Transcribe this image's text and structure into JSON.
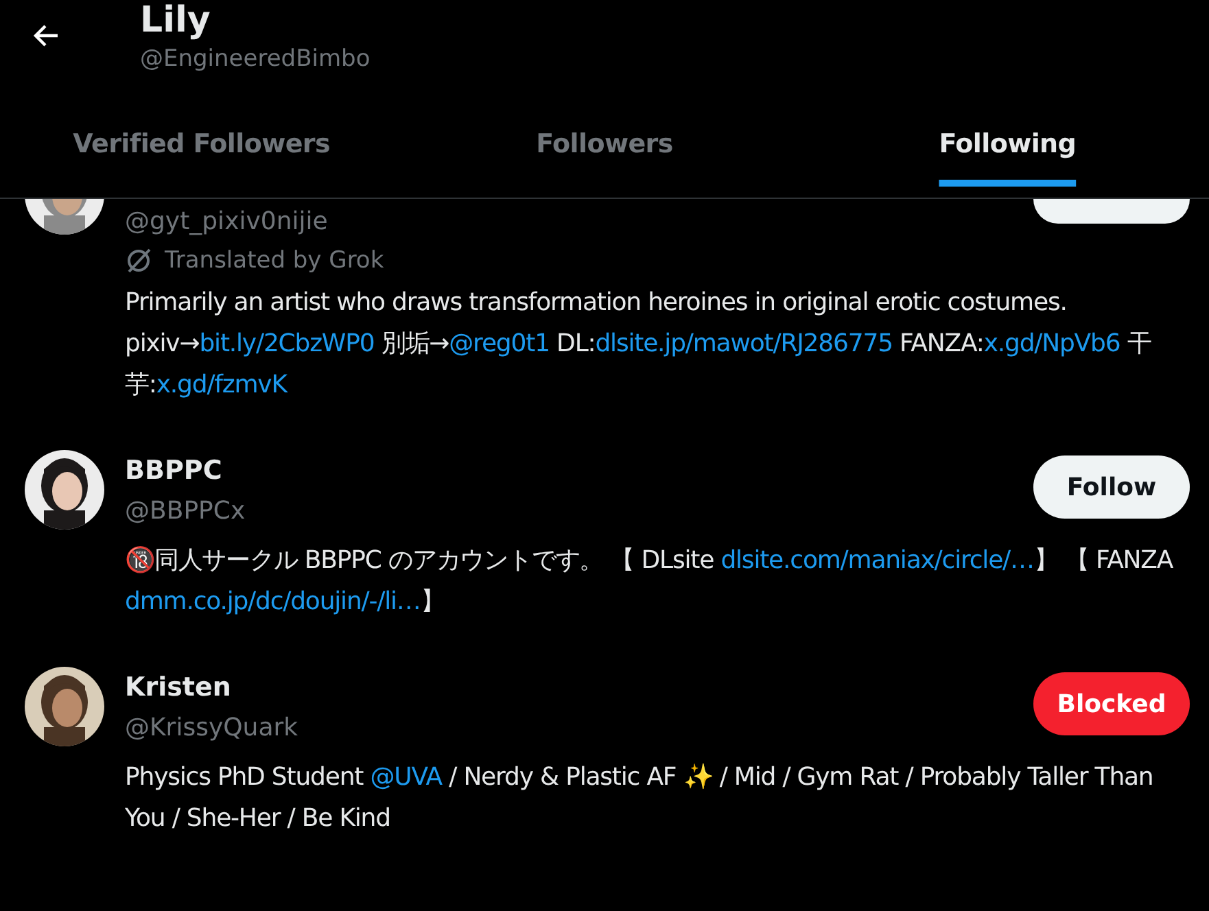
{
  "header": {
    "title": "Lily",
    "handle": "@EngineeredBimbo"
  },
  "tabs": [
    {
      "label": "Verified Followers",
      "selected": false
    },
    {
      "label": "Followers",
      "selected": false
    },
    {
      "label": "Following",
      "selected": true
    }
  ],
  "users": [
    {
      "handle": "@gyt_pixiv0nijie",
      "translated_note": "Translated by Grok",
      "button": {
        "kind": "follow"
      },
      "bio": [
        {
          "kind": "text",
          "text": "Primarily an artist who draws transformation heroines in original erotic costumes. pixiv→"
        },
        {
          "kind": "link",
          "text": "bit.ly/2CbzWP0"
        },
        {
          "kind": "text",
          "text": " 別垢→"
        },
        {
          "kind": "link",
          "text": "@reg0t1"
        },
        {
          "kind": "text",
          "text": " DL:"
        },
        {
          "kind": "link",
          "text": "dlsite.jp/mawot/RJ286775"
        },
        {
          "kind": "text",
          "text": " FANZA:"
        },
        {
          "kind": "link",
          "text": "x.gd/NpVb6"
        },
        {
          "kind": "text",
          "text": " 干芋:"
        },
        {
          "kind": "link",
          "text": "x.gd/fzmvK"
        }
      ]
    },
    {
      "name": "BBPPC",
      "handle": "@BBPPCx",
      "button": {
        "kind": "follow",
        "label": "Follow"
      },
      "bio": [
        {
          "kind": "text",
          "text": "🔞同人サークル BBPPC のアカウントです。 【 DLsite "
        },
        {
          "kind": "link",
          "text": "dlsite.com/maniax/circle/…"
        },
        {
          "kind": "text",
          "text": "】 【 FANZA "
        },
        {
          "kind": "link",
          "text": "dmm.co.jp/dc/doujin/-/li…"
        },
        {
          "kind": "text",
          "text": "】"
        }
      ]
    },
    {
      "name": "Kristen",
      "handle": "@KrissyQuark",
      "button": {
        "kind": "blocked",
        "label": "Blocked"
      },
      "bio": [
        {
          "kind": "text",
          "text": "Physics PhD Student "
        },
        {
          "kind": "link",
          "text": "@UVA"
        },
        {
          "kind": "text",
          "text": " / Nerdy & Plastic AF ✨ / Mid / Gym Rat / Probably Taller Than You / She-Her / Be Kind"
        }
      ]
    }
  ]
}
